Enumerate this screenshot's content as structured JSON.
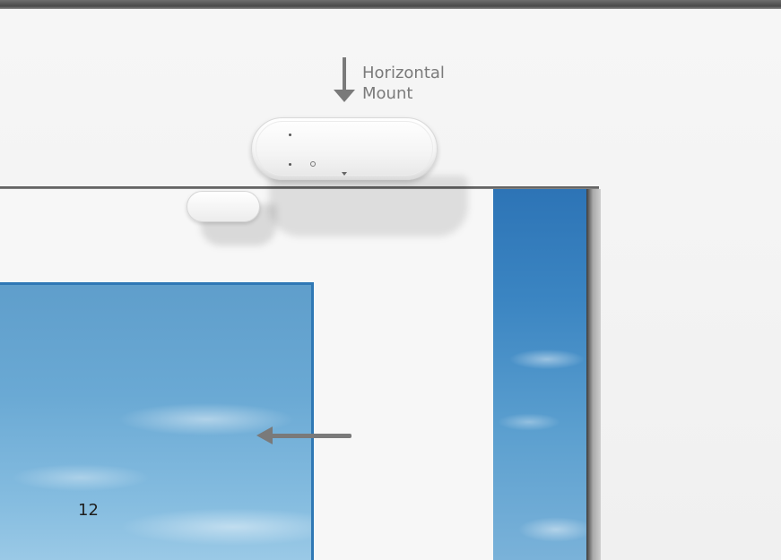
{
  "labels": {
    "mount_line1": "Horizontal",
    "mount_line2": "Mount"
  },
  "page": {
    "number": "12"
  },
  "icons": {
    "down_arrow": "arrow-down-icon",
    "left_arrow": "arrow-left-icon"
  },
  "colors": {
    "arrow": "#7a7a7a",
    "label_text": "#7a7a7a",
    "sky": "#6aa9d4",
    "window_frame": "#2f78b5"
  }
}
